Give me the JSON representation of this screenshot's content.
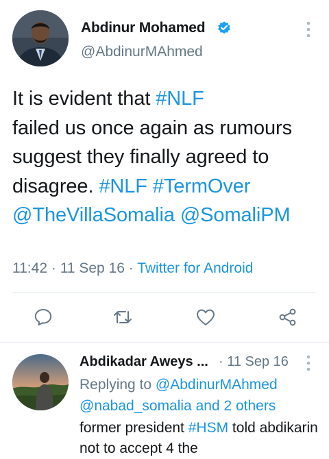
{
  "main_tweet": {
    "author_name": "Abdinur Mohamed",
    "handle": "@AbdinurMAhmed",
    "verified": true,
    "text": {
      "p1": "It is evident that ",
      "tag1": "#NLF",
      "p2": "failed us once again as rumours suggest they finally agreed to disagree. ",
      "tag2": "#NLF",
      "tag3": "#TermOver",
      "mention1": "@TheVillaSomalia",
      "mention2": "@SomaliPM"
    },
    "time": "11:42",
    "date": "11 Sep 16",
    "separator": "·",
    "source": "Twitter for Android",
    "avatar_icon": "profile-photo-man-in-suit"
  },
  "actions": {
    "reply_icon": "speech-bubble-icon",
    "retweet_icon": "retweet-icon",
    "like_icon": "heart-icon",
    "share_icon": "share-icon"
  },
  "reply_tweet": {
    "author_name": "Abdikadar Aweys ...",
    "date": "· 11 Sep 16",
    "replying_prefix": "Replying to ",
    "replying_mention": "@AbdinurMAhmed",
    "replying_mention2": "@nabad_somalia",
    "replying_suffix": " and 2 others",
    "text_p1": "former president ",
    "text_tag": "#HSM",
    "text_p2": " told abdikarin not to accept 4 the",
    "avatar_icon": "profile-photo-man-outdoors"
  },
  "colors": {
    "link": "#1b95e0",
    "muted": "#657786",
    "divider": "#e1e8ed",
    "verified": "#1da1f2"
  }
}
